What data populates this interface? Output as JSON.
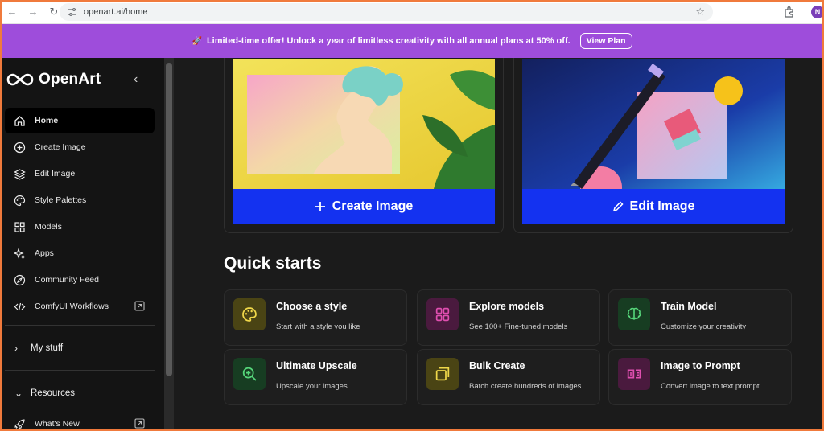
{
  "browser": {
    "url": "openart.ai/home",
    "profile_initial": "N"
  },
  "banner": {
    "text": "Limited-time offer! Unlock a year of limitless creativity with all annual plans at 50% off.",
    "button": "View Plan"
  },
  "sidebar": {
    "brand": "OpenArt",
    "items": [
      {
        "label": "Home",
        "icon": "home-icon"
      },
      {
        "label": "Create Image",
        "icon": "plus-circle-icon"
      },
      {
        "label": "Edit Image",
        "icon": "layers-icon"
      },
      {
        "label": "Style Palettes",
        "icon": "palette-icon"
      },
      {
        "label": "Models",
        "icon": "grid-icon"
      },
      {
        "label": "Apps",
        "icon": "sparkle-icon"
      },
      {
        "label": "Community Feed",
        "icon": "compass-icon"
      },
      {
        "label": "ComfyUI Workflows",
        "icon": "code-icon"
      }
    ],
    "my_stuff": "My stuff",
    "resources": "Resources",
    "whats_new": "What's New"
  },
  "hero": {
    "create_label": "Create Image",
    "edit_label": "Edit Image"
  },
  "quick_starts": {
    "title": "Quick starts",
    "cards": [
      {
        "title": "Choose a style",
        "subtitle": "Start with a style you like",
        "icon": "palette-icon",
        "tile": "#4a4414",
        "color": "#f0d84a"
      },
      {
        "title": "Explore models",
        "subtitle": "See 100+ Fine-tuned models",
        "icon": "grid-icon",
        "tile": "#4a1a3e",
        "color": "#e04fb0"
      },
      {
        "title": "Train Model",
        "subtitle": "Customize your creativity",
        "icon": "brain-icon",
        "tile": "#173d22",
        "color": "#56d67a"
      },
      {
        "title": "Ultimate Upscale",
        "subtitle": "Upscale your images",
        "icon": "zoom-in-icon",
        "tile": "#173d22",
        "color": "#56d67a"
      },
      {
        "title": "Bulk Create",
        "subtitle": "Batch create hundreds of images",
        "icon": "stack-icon",
        "tile": "#4a4414",
        "color": "#f0d84a"
      },
      {
        "title": "Image to Prompt",
        "subtitle": "Convert image to text prompt",
        "icon": "image-text-icon",
        "tile": "#4a1a3e",
        "color": "#e04fb0"
      }
    ]
  }
}
